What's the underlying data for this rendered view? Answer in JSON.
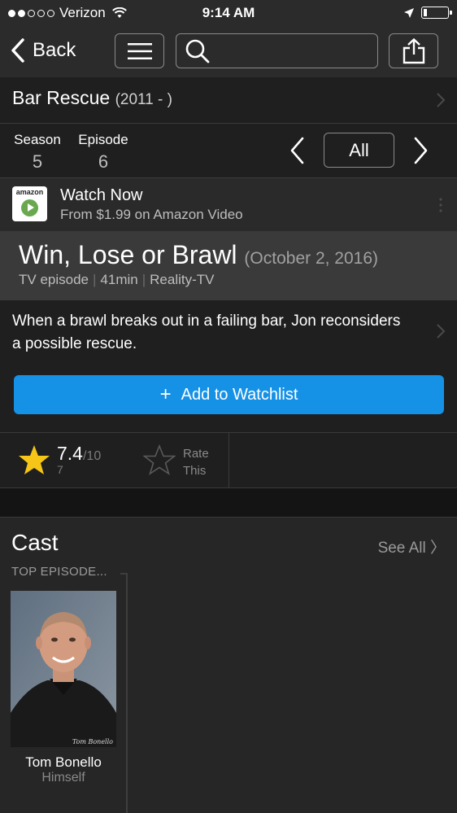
{
  "status_bar": {
    "carrier": "Verizon",
    "signal_bars_filled": 2,
    "signal_bars_total": 5,
    "time": "9:14 AM",
    "battery_level": 0.15
  },
  "nav": {
    "back_label": "Back",
    "search_placeholder": ""
  },
  "series": {
    "title": "Bar Rescue",
    "years": "(2011 -  )"
  },
  "episode_nav": {
    "season_label": "Season",
    "season_value": "5",
    "episode_label": "Episode",
    "episode_value": "6",
    "all_label": "All"
  },
  "watch": {
    "logo_text": "amazon",
    "title": "Watch Now",
    "subtitle": "From $1.99 on Amazon Video"
  },
  "episode": {
    "title": "Win, Lose or Brawl",
    "date": "(October 2, 2016)",
    "type": "TV episode",
    "runtime": "41min",
    "genre": "Reality-TV",
    "plot": "When a brawl breaks out in a failing bar, Jon reconsiders a possible rescue.",
    "watchlist_label": "Add to Watchlist"
  },
  "rating": {
    "value": "7.4",
    "out_of": "/10",
    "count": "7",
    "rate_line1": "Rate",
    "rate_line2": "This"
  },
  "cast": {
    "heading": "Cast",
    "see_all": "See All 〉",
    "section_label": "TOP EPISODE...",
    "members": [
      {
        "name": "Tom Bonello",
        "role": "Himself",
        "photo_caption": "Tom Bonello"
      }
    ]
  },
  "colors": {
    "accent_blue": "#1591e6",
    "star_gold": "#f5c518",
    "background": "#1f1f1f"
  }
}
